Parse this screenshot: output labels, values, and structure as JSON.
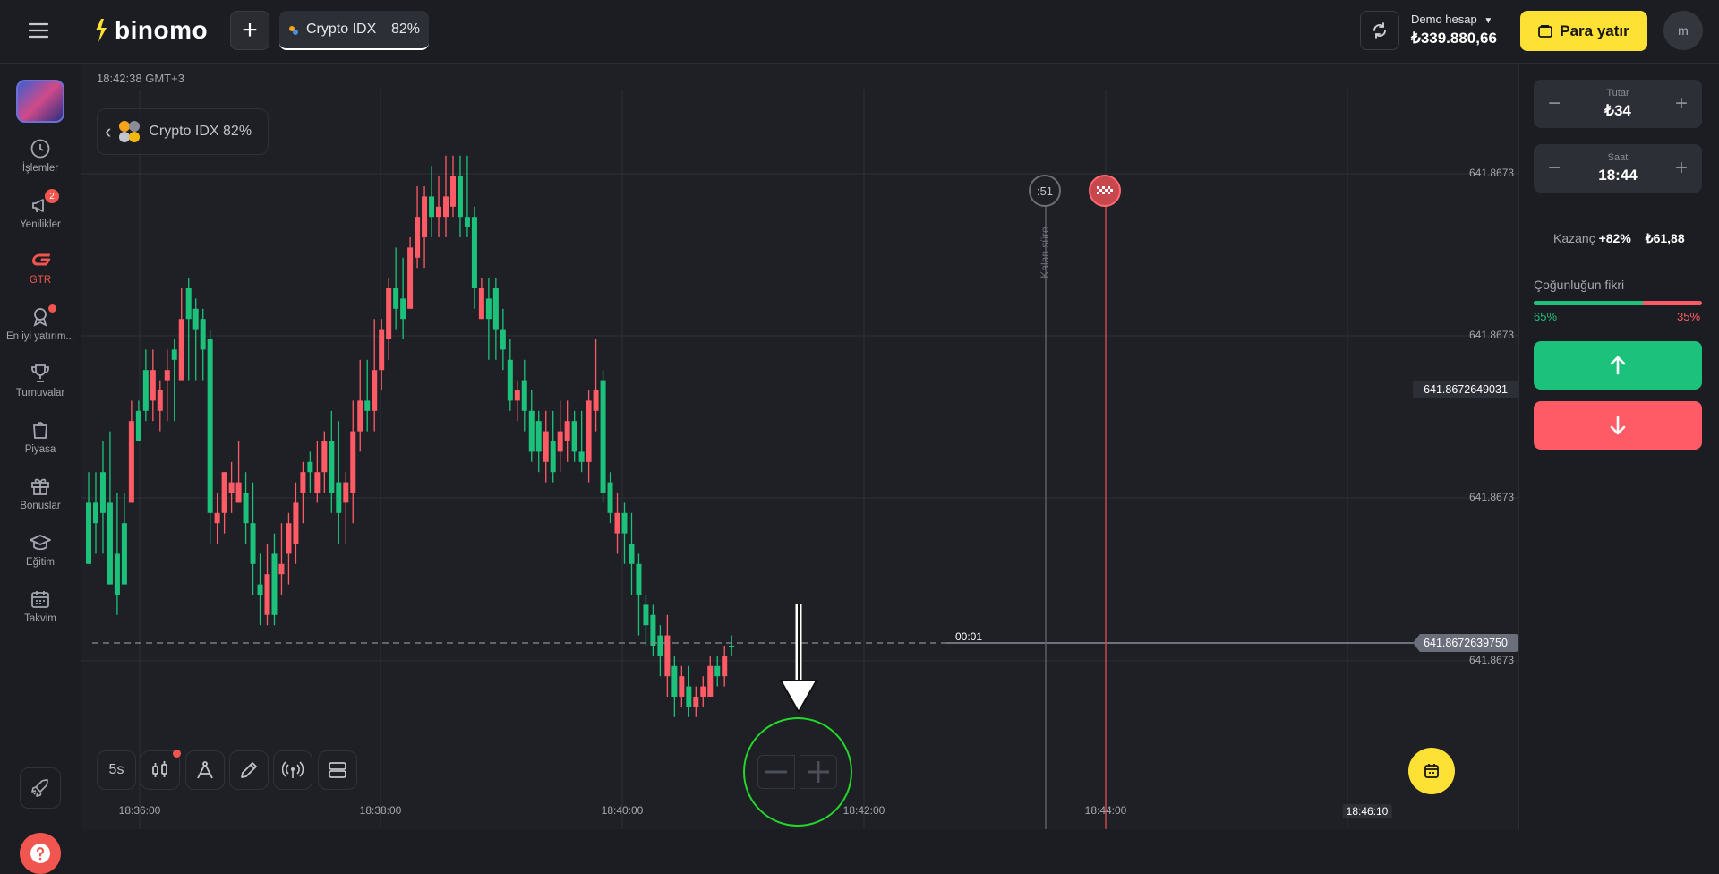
{
  "header": {
    "logo_text": "binomo",
    "asset_tab": {
      "name": "Crypto IDX",
      "payout": "82%"
    },
    "account": {
      "label": "Demo hesap",
      "balance": "₺339.880,66"
    },
    "deposit_label": "Para yatır",
    "avatar_initial": "m"
  },
  "sidebar": {
    "items": [
      {
        "label": "İşlemler",
        "icon": "clock-icon"
      },
      {
        "label": "Yenilikler",
        "icon": "megaphone-icon",
        "badge": "2"
      },
      {
        "label": "GTR",
        "icon": "gtr-icon",
        "active": true
      },
      {
        "label": "En iyi yatırım...",
        "icon": "award-icon",
        "dot": true
      },
      {
        "label": "Turnuvalar",
        "icon": "trophy-icon"
      },
      {
        "label": "Piyasa",
        "icon": "bag-icon"
      },
      {
        "label": "Bonuslar",
        "icon": "gift-icon"
      },
      {
        "label": "Eğitim",
        "icon": "graduation-cap-icon"
      },
      {
        "label": "Takvim",
        "icon": "calendar-icon"
      }
    ]
  },
  "chart": {
    "clock": "18:42:38 GMT+3",
    "asset_card": "Crypto IDX 82%",
    "timer_badge": ":51",
    "remaining_label": "Kalan süre",
    "countdown": "00:01",
    "current_price": "641.8672639750",
    "hover_price": "641.8672649031",
    "y_labels": [
      "641.8673",
      "641.8673",
      "641.8673",
      "641.8673"
    ],
    "x_labels": [
      "18:36:00",
      "18:38:00",
      "18:40:00",
      "18:42:00",
      "18:44:00",
      "18:46:10"
    ],
    "toolbar": {
      "timeframe": "5s"
    },
    "colors": {
      "up": "#1cc27b",
      "down": "#ff5b67",
      "highlight": "#22d62a"
    }
  },
  "chart_data": {
    "type": "candlestick",
    "x_range": [
      "18:36:00",
      "18:46:10"
    ],
    "candles": [
      [
        16,
        28,
        16,
        34
      ],
      [
        24,
        28,
        18,
        34
      ],
      [
        26,
        34,
        18,
        40
      ],
      [
        12,
        28,
        12,
        42
      ],
      [
        10,
        18,
        6,
        30
      ],
      [
        12,
        24,
        12,
        30
      ],
      [
        44,
        28,
        28,
        48
      ],
      [
        40,
        46,
        40,
        48
      ],
      [
        46,
        54,
        44,
        58
      ],
      [
        54,
        48,
        44,
        58
      ],
      [
        50,
        46,
        42,
        52
      ],
      [
        54,
        52,
        44,
        58
      ],
      [
        56,
        58,
        44,
        60
      ],
      [
        64,
        52,
        54,
        70
      ],
      [
        64,
        70,
        52,
        72
      ],
      [
        62,
        66,
        52,
        68
      ],
      [
        58,
        64,
        52,
        66
      ],
      [
        26,
        60,
        20,
        62
      ],
      [
        26,
        24,
        20,
        30
      ],
      [
        34,
        26,
        22,
        34
      ],
      [
        32,
        30,
        26,
        36
      ],
      [
        32,
        28,
        28,
        40
      ],
      [
        24,
        30,
        20,
        34
      ],
      [
        16,
        24,
        10,
        32
      ],
      [
        10,
        12,
        4,
        18
      ],
      [
        14,
        6,
        4,
        20
      ],
      [
        6,
        18,
        4,
        22
      ],
      [
        16,
        14,
        10,
        24
      ],
      [
        24,
        18,
        12,
        26
      ],
      [
        28,
        20,
        16,
        32
      ],
      [
        34,
        30,
        24,
        36
      ],
      [
        34,
        36,
        30,
        38
      ],
      [
        34,
        30,
        28,
        40
      ],
      [
        40,
        34,
        30,
        42
      ],
      [
        30,
        40,
        26,
        46
      ],
      [
        26,
        32,
        20,
        44
      ],
      [
        32,
        28,
        20,
        34
      ],
      [
        42,
        30,
        24,
        48
      ],
      [
        48,
        42,
        38,
        56
      ],
      [
        46,
        48,
        42,
        56
      ],
      [
        54,
        46,
        42,
        64
      ],
      [
        62,
        54,
        50,
        64
      ],
      [
        70,
        60,
        56,
        72
      ],
      [
        66,
        70,
        62,
        78
      ],
      [
        64,
        68,
        60,
        76
      ],
      [
        78,
        66,
        66,
        80
      ],
      [
        84,
        76,
        74,
        90
      ],
      [
        88,
        80,
        74,
        90
      ],
      [
        84,
        88,
        80,
        94
      ],
      [
        86,
        84,
        80,
        92
      ],
      [
        88,
        84,
        80,
        96
      ],
      [
        92,
        86,
        84,
        96
      ],
      [
        84,
        92,
        80,
        96
      ],
      [
        82,
        84,
        80,
        96
      ],
      [
        70,
        84,
        66,
        86
      ],
      [
        70,
        64,
        64,
        72
      ],
      [
        64,
        68,
        56,
        72
      ],
      [
        62,
        70,
        56,
        72
      ],
      [
        58,
        62,
        54,
        66
      ],
      [
        48,
        56,
        46,
        60
      ],
      [
        50,
        48,
        44,
        52
      ],
      [
        46,
        52,
        42,
        56
      ],
      [
        38,
        46,
        36,
        50
      ],
      [
        38,
        44,
        34,
        46
      ],
      [
        42,
        36,
        32,
        46
      ],
      [
        34,
        40,
        32,
        46
      ],
      [
        42,
        38,
        34,
        48
      ],
      [
        44,
        40,
        36,
        48
      ],
      [
        38,
        44,
        36,
        46
      ],
      [
        36,
        38,
        34,
        46
      ],
      [
        48,
        36,
        32,
        50
      ],
      [
        50,
        46,
        42,
        60
      ],
      [
        30,
        52,
        28,
        54
      ],
      [
        26,
        32,
        24,
        34
      ],
      [
        26,
        22,
        18,
        30
      ],
      [
        22,
        26,
        16,
        28
      ],
      [
        16,
        20,
        10,
        26
      ],
      [
        10,
        16,
        2,
        18
      ],
      [
        4,
        8,
        0,
        10
      ],
      [
        0,
        6,
        -2,
        8
      ],
      [
        -2,
        2,
        -6,
        4
      ],
      [
        2,
        -6,
        -10,
        6
      ],
      [
        -10,
        -4,
        -14,
        -2
      ],
      [
        -6,
        -10,
        -12,
        -4
      ],
      [
        -12,
        -8,
        -14,
        -4
      ],
      [
        -10,
        -12,
        -14,
        -8
      ],
      [
        -8,
        -10,
        -12,
        -6
      ],
      [
        -4,
        -10,
        -10,
        -2
      ],
      [
        -6,
        -4,
        -8,
        -2
      ],
      [
        -2,
        -6,
        -8,
        0
      ],
      [
        0,
        0,
        -2,
        2
      ]
    ],
    "majority_opinion": {
      "up_percent": 65,
      "down_percent": 35
    }
  },
  "trade_panel": {
    "amount": {
      "label": "Tutar",
      "value": "₺34"
    },
    "time": {
      "label": "Saat",
      "value": "18:44"
    },
    "payout_label": "Kazanç",
    "payout_percent": "+82%",
    "payout_amount": "₺61,88",
    "majority_label": "Çoğunluğun fikri",
    "majority_up": "65%",
    "majority_down": "35%"
  }
}
